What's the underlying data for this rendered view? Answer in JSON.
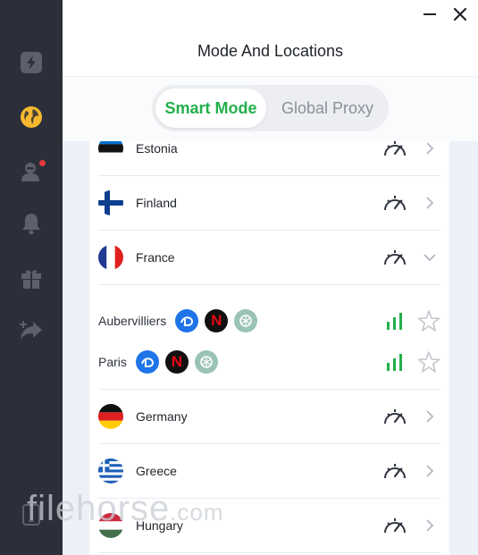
{
  "window": {
    "title": "Mode And Locations",
    "minimize_icon": "minimize-icon",
    "close_icon": "close-icon"
  },
  "sidebar": {
    "items": [
      {
        "name": "lightning",
        "icon": "lightning-icon",
        "active": false
      },
      {
        "name": "locations",
        "icon": "globe-icon",
        "active": true
      },
      {
        "name": "account",
        "icon": "user-icon",
        "badge": true
      },
      {
        "name": "notifications",
        "icon": "bell-icon"
      },
      {
        "name": "gifts",
        "icon": "gift-icon"
      },
      {
        "name": "share",
        "icon": "share-icon"
      },
      {
        "name": "device",
        "icon": "tablet-icon"
      }
    ]
  },
  "mode_toggle": {
    "active_label": "Smart Mode",
    "inactive_label": "Global Proxy"
  },
  "locations": {
    "countries": [
      {
        "name": "Estonia",
        "flag": "estonia-flag",
        "expanded": false
      },
      {
        "name": "Finland",
        "flag": "finland-flag",
        "expanded": false
      },
      {
        "name": "France",
        "flag": "france-flag",
        "expanded": true
      },
      {
        "name": "Germany",
        "flag": "germany-flag",
        "expanded": false
      },
      {
        "name": "Greece",
        "flag": "greece-flag",
        "expanded": false
      },
      {
        "name": "Hungary",
        "flag": "hungary-flag",
        "expanded": false
      }
    ],
    "france_cities": [
      {
        "name": "Aubervilliers",
        "services": [
          "disney-plus-icon",
          "netflix-icon",
          "chatgpt-icon"
        ],
        "signal": "full",
        "favorite": false
      },
      {
        "name": "Paris",
        "services": [
          "disney-plus-icon",
          "netflix-icon",
          "chatgpt-icon"
        ],
        "signal": "full",
        "favorite": false
      }
    ],
    "netflix_letter": "N"
  },
  "colors": {
    "accent_green": "#22b04b",
    "sidebar_bg": "#2b2f3a",
    "globe_yellow": "#f5b82e"
  },
  "watermark": {
    "text": "filehorse",
    "suffix": ".com"
  }
}
